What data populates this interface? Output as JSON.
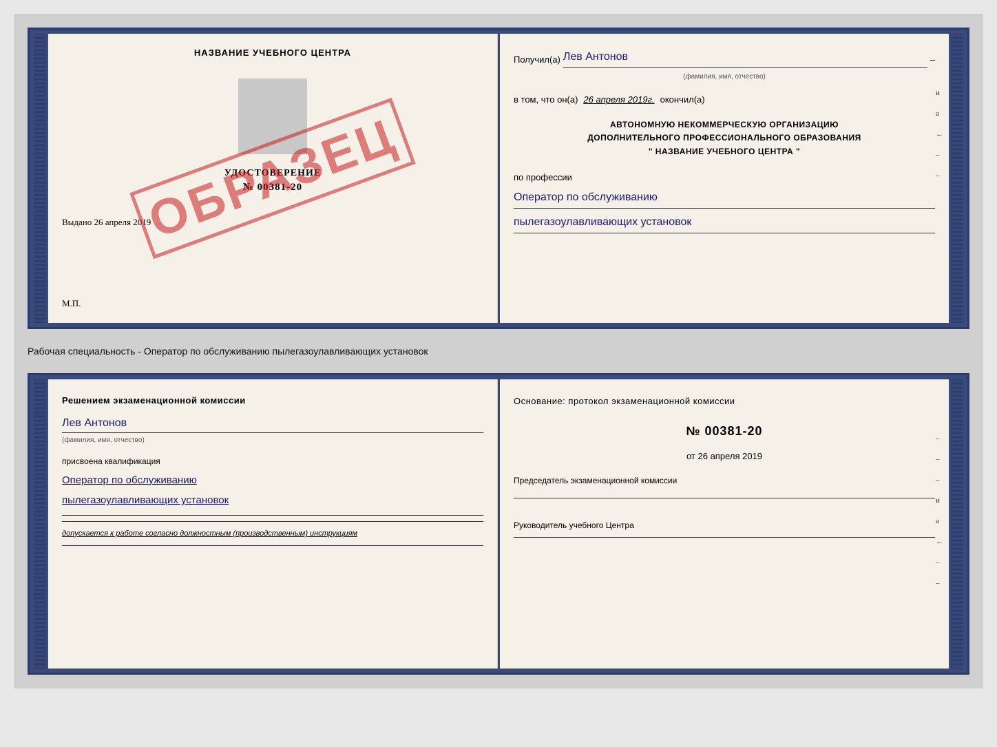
{
  "page": {
    "background_color": "#d0d0d0"
  },
  "top_document": {
    "left_page": {
      "training_center_title": "НАЗВАНИЕ УЧЕБНОГО ЦЕНТРА",
      "certificate_label": "УДОСТОВЕРЕНИЕ",
      "certificate_number": "№ 00381-20",
      "issued_date_label": "Выдано",
      "issued_date_value": "26 апреля 2019",
      "mp_label": "М.П.",
      "stamp_text": "ОБРАЗЕЦ"
    },
    "right_page": {
      "recipient_label": "Получил(а)",
      "recipient_name": "Лев Антонов",
      "name_hint": "(фамилия, имя, отчество)",
      "date_prefix": "в том, что он(а)",
      "date_value": "26 апреля 2019г.",
      "date_suffix": "окончил(а)",
      "org_line1": "АВТОНОМНУЮ НЕКОММЕРЧЕСКУЮ ОРГАНИЗАЦИЮ",
      "org_line2": "ДОПОЛНИТЕЛЬНОГО ПРОФЕССИОНАЛЬНОГО ОБРАЗОВАНИЯ",
      "org_line3": "\"   НАЗВАНИЕ УЧЕБНОГО ЦЕНТРА   \"",
      "profession_label": "по профессии",
      "profession_line1": "Оператор по обслуживанию",
      "profession_line2": "пылегазоулавливающих установок",
      "side_marks": [
        "и",
        "а",
        "←",
        "–",
        "–",
        "–",
        "–"
      ]
    }
  },
  "separator": {
    "text": "Рабочая специальность - Оператор по обслуживанию пылегазоулавливающих установок"
  },
  "bottom_document": {
    "left_page": {
      "decision_title": "Решением экзаменационной комиссии",
      "person_name": "Лев Антонов",
      "name_hint": "(фамилия, имя, отчество)",
      "qualification_label": "присвоена квалификация",
      "qualification_line1": "Оператор по обслуживанию",
      "qualification_line2": "пылегазоулавливающих установок",
      "admission_text": "допускается к работе согласно должностным (производственным) инструкциям"
    },
    "right_page": {
      "basis_title": "Основание: протокол экзаменационной комиссии",
      "protocol_number": "№  00381-20",
      "protocol_date_prefix": "от",
      "protocol_date_value": "26 апреля 2019",
      "chairman_label": "Председатель экзаменационной комиссии",
      "director_label": "Руководитель учебного Центра",
      "side_marks": [
        "–",
        "–",
        "–",
        "и",
        "а",
        "←",
        "–",
        "–",
        "–",
        "–"
      ]
    }
  }
}
